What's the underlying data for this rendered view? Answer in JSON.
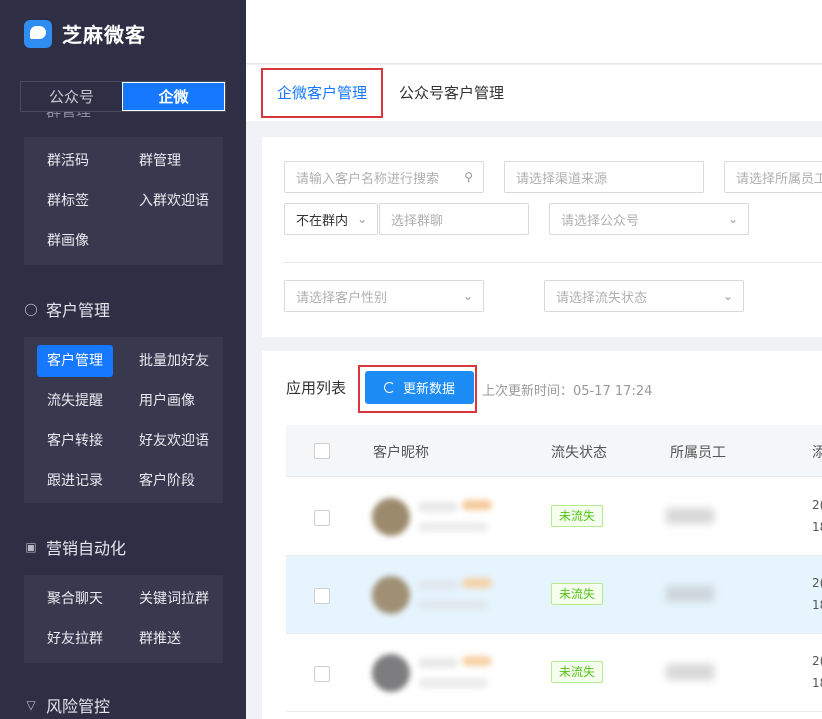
{
  "app": {
    "name": "芝麻微客"
  },
  "switch": {
    "left": "公众号",
    "right": "企微"
  },
  "peek_title": "群管理",
  "group_menu": [
    "群活码",
    "群管理",
    "群标签",
    "入群欢迎语",
    "群画像"
  ],
  "sections": {
    "customer": {
      "title": "客户管理",
      "icon": "user-icon"
    },
    "marketing": {
      "title": "营销自动化",
      "icon": "automation-icon"
    },
    "risk": {
      "title": "风险管控",
      "icon": "shield-icon"
    }
  },
  "customer_menu": [
    "客户管理",
    "批量加好友",
    "流失提醒",
    "用户画像",
    "客户转接",
    "好友欢迎语",
    "跟进记录",
    "客户阶段"
  ],
  "marketing_menu": [
    "聚合聊天",
    "关键词拉群",
    "好友拉群",
    "群推送"
  ],
  "tabs": [
    "企微客户管理",
    "公众号客户管理"
  ],
  "filters": {
    "search_placeholder": "请输入客户名称进行搜索",
    "channel_placeholder": "请选择渠道来源",
    "employee_placeholder": "请选择所属员工",
    "group_status": "不在群内",
    "group_chat_placeholder": "选择群聊",
    "official_placeholder": "请选择公众号",
    "gender_placeholder": "请选择客户性别",
    "churn_placeholder": "请选择流失状态"
  },
  "list": {
    "title": "应用列表",
    "refresh_label": "更新数据",
    "last_update": "上次更新时间：05-17 17:24",
    "columns": [
      "客户昵称",
      "流失状态",
      "所属员工",
      "添"
    ],
    "rows": [
      {
        "status": "未流失",
        "date_line1": "2(",
        "date_line2": "18"
      },
      {
        "status": "未流失",
        "date_line1": "2(",
        "date_line2": "18"
      },
      {
        "status": "未流失",
        "date_line1": "2(",
        "date_line2": "18"
      }
    ]
  },
  "colors": {
    "sidebar": "#2e2f45",
    "accent": "#1677ff",
    "highlight_border": "#d9363e",
    "tag_green": "#52c41a"
  }
}
